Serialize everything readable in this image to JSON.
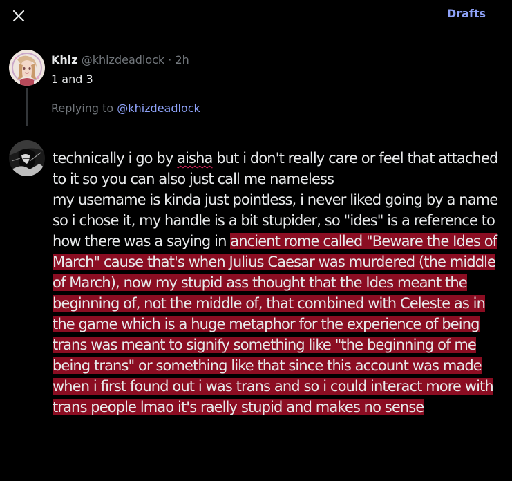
{
  "topbar": {
    "close_icon": "close-icon",
    "drafts_label": "Drafts",
    "accent_color": "#8ea2f8"
  },
  "parent_tweet": {
    "name": "Khiz",
    "handle": "@khizdeadlock",
    "separator": " · ",
    "time": "2h",
    "text": "1 and 3"
  },
  "replying": {
    "prefix": "Replying to ",
    "mention": "@khizdeadlock"
  },
  "composer": {
    "para1_pre": "technically i go by ",
    "para1_misspelled": "aisha",
    "para1_post": " but i don't really care or feel that attached to it so you can also just call me nameless",
    "para2_plain": "my username is kinda just pointless, i never liked going by a name so i chose it, my handle is a bit stupider, so \"ides\" is a reference to how there was a saying in ",
    "para2_highlighted": "ancient rome called \"Beware the Ides of March\" cause that's when Julius Caesar was murdered (the middle of March), now my stupid ass thought that the Ides meant the beginning of, not the middle of, that combined with Celeste as in the game which is a huge metaphor for the experience of being trans was meant to signify something like \"the beginning of me being trans\" or something like that since this account was made when i first found out i was trans and so i could interact more with trans people lmao it's raelly stupid and makes no sense",
    "highlight_color": "#8b0d22",
    "spellcheck_color": "#e0245e"
  }
}
